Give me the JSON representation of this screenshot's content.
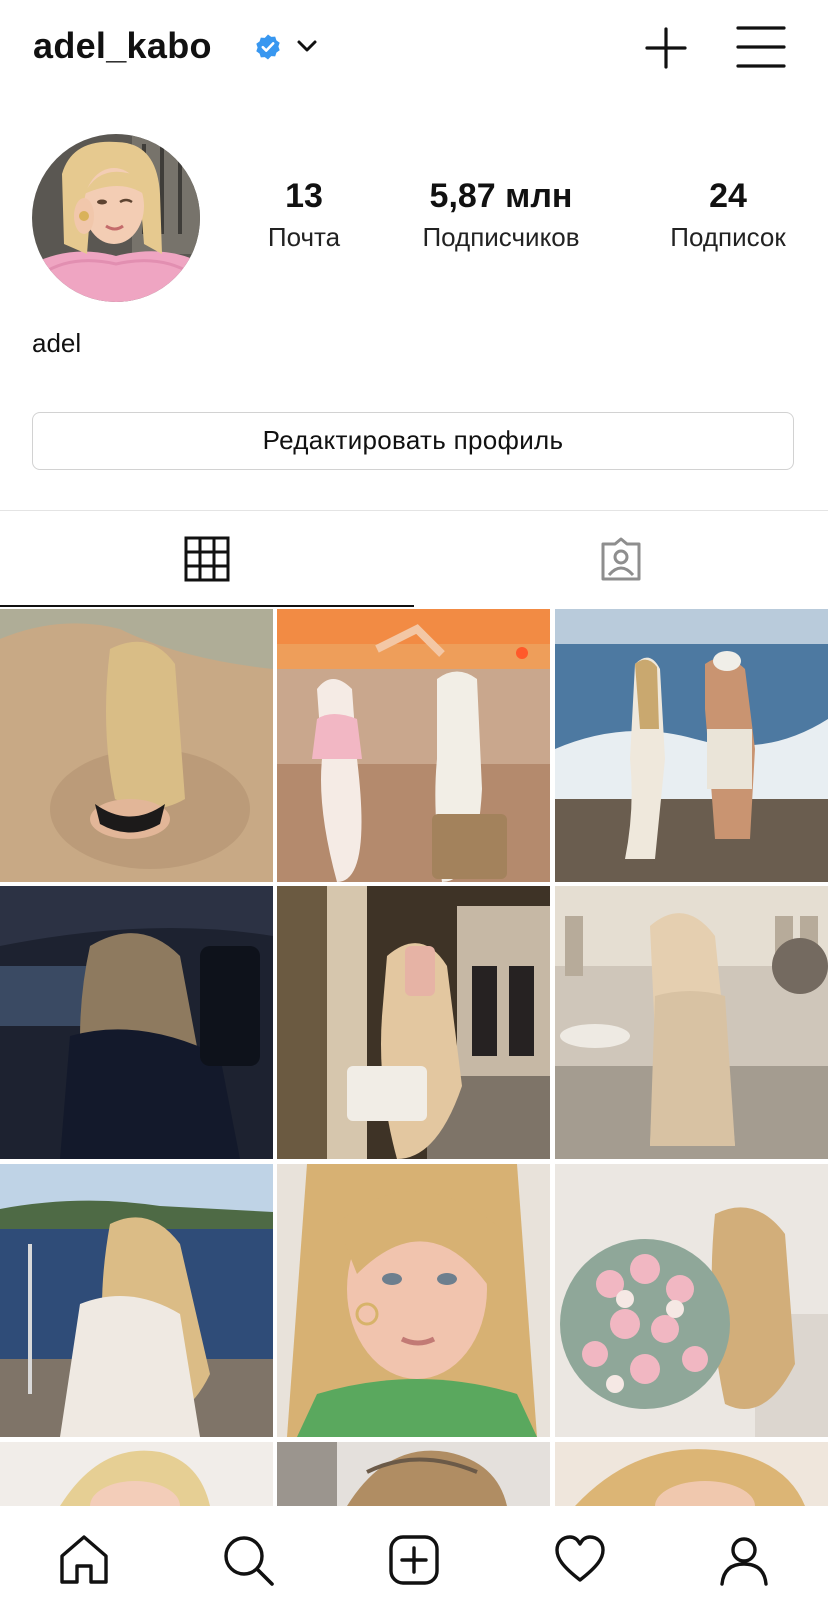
{
  "header": {
    "username": "adel_kabo",
    "verified_icon": "verified-badge-icon",
    "chevron_icon": "chevron-down-icon",
    "new_post_icon": "plus-icon",
    "menu_icon": "hamburger-menu-icon"
  },
  "profile": {
    "display_name": "adel",
    "stats": [
      {
        "value": "13",
        "label": "Почта"
      },
      {
        "value": "5,87 млн",
        "label": "Подписчиков"
      },
      {
        "value": "24",
        "label": "Подписок"
      }
    ],
    "edit_button_label": "Редактировать профиль"
  },
  "tabs": [
    {
      "icon": "grid-icon",
      "active": true
    },
    {
      "icon": "tagged-person-icon",
      "active": false
    }
  ],
  "posts": [
    {
      "scene": "beach-sand"
    },
    {
      "scene": "sunset-beach-two-girls"
    },
    {
      "scene": "sea-couple-walking"
    },
    {
      "scene": "car-interior"
    },
    {
      "scene": "mirror-selfie-store"
    },
    {
      "scene": "terrace-satin-dress"
    },
    {
      "scene": "boat-sea"
    },
    {
      "scene": "portrait-green-top"
    },
    {
      "scene": "flowers-bouquet"
    },
    {
      "scene": "portrait-partial"
    },
    {
      "scene": "portrait-partial"
    },
    {
      "scene": "portrait-partial"
    }
  ],
  "bottom_nav": [
    {
      "icon": "home-icon"
    },
    {
      "icon": "search-icon"
    },
    {
      "icon": "add-post-icon"
    },
    {
      "icon": "heart-icon"
    },
    {
      "icon": "profile-icon"
    }
  ],
  "colors": {
    "verified_blue": "#3897f0",
    "text": "#111111",
    "border": "#d2d2d2"
  }
}
